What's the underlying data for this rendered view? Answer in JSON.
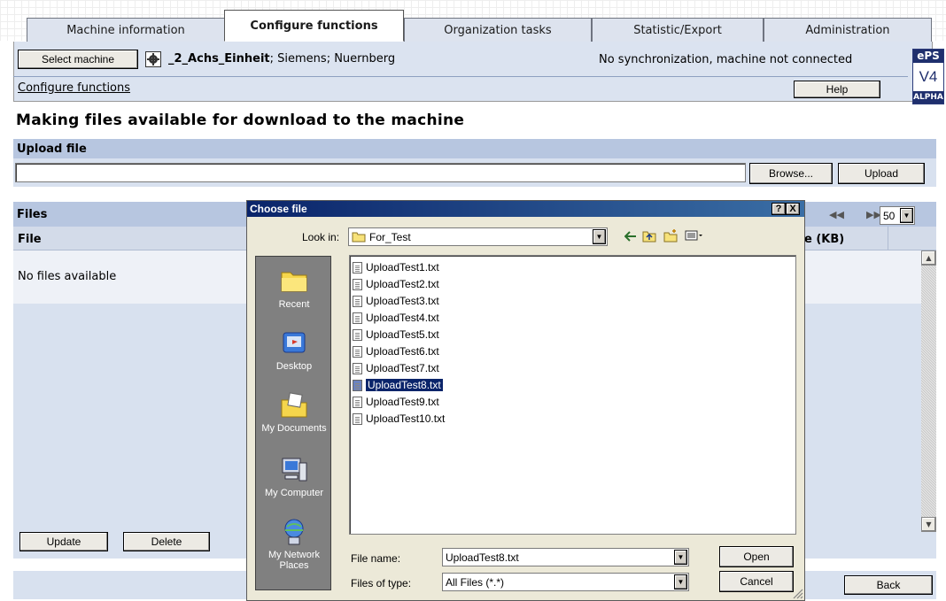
{
  "tabs": [
    {
      "label": "Machine information",
      "active": false
    },
    {
      "label": "Configure functions",
      "active": true
    },
    {
      "label": "Organization tasks",
      "active": false
    },
    {
      "label": "Statistic/Export",
      "active": false
    },
    {
      "label": "Administration",
      "active": false
    }
  ],
  "header": {
    "select_machine_label": "Select machine",
    "machine_name": "_2_Achs_Einheit",
    "machine_details": "; Siemens; Nuernberg",
    "sync_status": "No synchronization, machine not connected",
    "breadcrumb": "Configure functions",
    "help_label": "Help"
  },
  "logo": {
    "line1": "ePS",
    "line2": "V4",
    "line3": "ALPHA"
  },
  "page_title": "Making files available for download to the machine",
  "upload": {
    "heading": "Upload file",
    "path_value": "",
    "browse_label": "Browse...",
    "upload_label": "Upload"
  },
  "files": {
    "heading": "Files",
    "col_file": "File",
    "col_size": "e (KB)",
    "empty_text": "No files available",
    "page_size": "50",
    "update_label": "Update",
    "delete_label": "Delete",
    "back_label": "Back"
  },
  "dialog": {
    "title": "Choose file",
    "help_btn": "?",
    "close_btn": "X",
    "look_in_label": "Look in:",
    "look_in_value": "For_Test",
    "places": [
      {
        "label": "Recent",
        "icon": "recent-folder-icon"
      },
      {
        "label": "Desktop",
        "icon": "desktop-icon"
      },
      {
        "label": "My Documents",
        "icon": "my-documents-icon"
      },
      {
        "label": "My Computer",
        "icon": "my-computer-icon"
      },
      {
        "label": "My Network Places",
        "icon": "network-places-icon"
      }
    ],
    "files": [
      {
        "name": "UploadTest1.txt",
        "selected": false
      },
      {
        "name": "UploadTest2.txt",
        "selected": false
      },
      {
        "name": "UploadTest3.txt",
        "selected": false
      },
      {
        "name": "UploadTest4.txt",
        "selected": false
      },
      {
        "name": "UploadTest5.txt",
        "selected": false
      },
      {
        "name": "UploadTest6.txt",
        "selected": false
      },
      {
        "name": "UploadTest7.txt",
        "selected": false
      },
      {
        "name": "UploadTest8.txt",
        "selected": true
      },
      {
        "name": "UploadTest9.txt",
        "selected": false
      },
      {
        "name": "UploadTest10.txt",
        "selected": false
      }
    ],
    "file_name_label": "File name:",
    "file_name_value": "UploadTest8.txt",
    "file_type_label": "Files of type:",
    "file_type_value": "All Files (*.*)",
    "open_label": "Open",
    "cancel_label": "Cancel"
  }
}
